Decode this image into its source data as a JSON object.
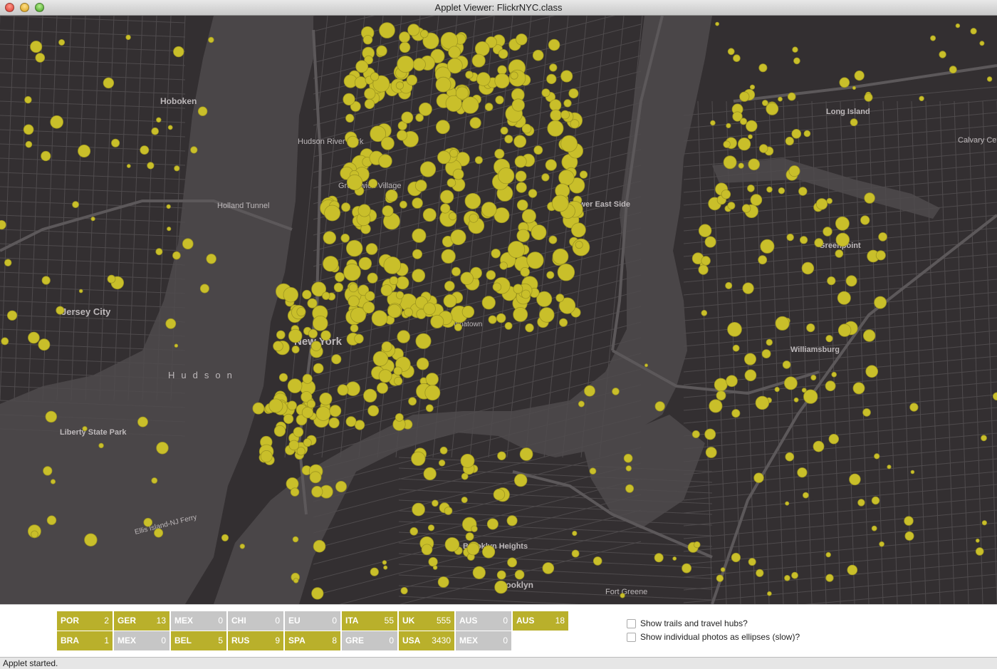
{
  "window": {
    "title": "Applet Viewer: FlickrNYC.class"
  },
  "map": {
    "labels": {
      "hoboken": "Hoboken",
      "jersey_city": "Jersey City",
      "new_york": "New York",
      "hudson": "Hudson",
      "hudson_river_park": "Hudson River Park",
      "greenwich_village": "Greenwich Village",
      "lower_east_side": "Lower East Side",
      "long_island": "Long Island",
      "greenpoint": "Greenpoint",
      "williamsburg": "Williamsburg",
      "brooklyn_heights": "Brooklyn Heights",
      "brooklyn": "Brooklyn",
      "liberty_state_park": "Liberty State Park",
      "holland_tunnel": "Holland Tunnel",
      "calvary_cem": "Calvary Cem",
      "fort_greene": "Fort Greene",
      "chinatown": "Chinatown",
      "ellis_island_ferry": "Ellis Island-NJ Ferry"
    },
    "dot_color": "#c9bf2a",
    "background_color": "#332f31"
  },
  "countries": [
    {
      "code": "POR",
      "count": "2",
      "active": true
    },
    {
      "code": "GER",
      "count": "13",
      "active": true
    },
    {
      "code": "MEX",
      "count": "0",
      "active": false
    },
    {
      "code": "CHI",
      "count": "0",
      "active": false
    },
    {
      "code": "EU",
      "count": "0",
      "active": false
    },
    {
      "code": "ITA",
      "count": "55",
      "active": true
    },
    {
      "code": "UK",
      "count": "555",
      "active": true
    },
    {
      "code": "AUS",
      "count": "0",
      "active": false
    },
    {
      "code": "AUS",
      "count": "18",
      "active": true
    },
    {
      "code": "BRA",
      "count": "1",
      "active": true
    },
    {
      "code": "MEX",
      "count": "0",
      "active": false
    },
    {
      "code": "BEL",
      "count": "5",
      "active": true
    },
    {
      "code": "RUS",
      "count": "9",
      "active": true
    },
    {
      "code": "SPA",
      "count": "8",
      "active": true
    },
    {
      "code": "GRE",
      "count": "0",
      "active": false
    },
    {
      "code": "USA",
      "count": "3430",
      "active": true
    },
    {
      "code": "MEX",
      "count": "0",
      "active": false
    }
  ],
  "options": {
    "trails": "Show trails and travel hubs?",
    "ellipses": "Show individual photos as ellipses (slow)?"
  },
  "status": {
    "text": "Applet started."
  }
}
